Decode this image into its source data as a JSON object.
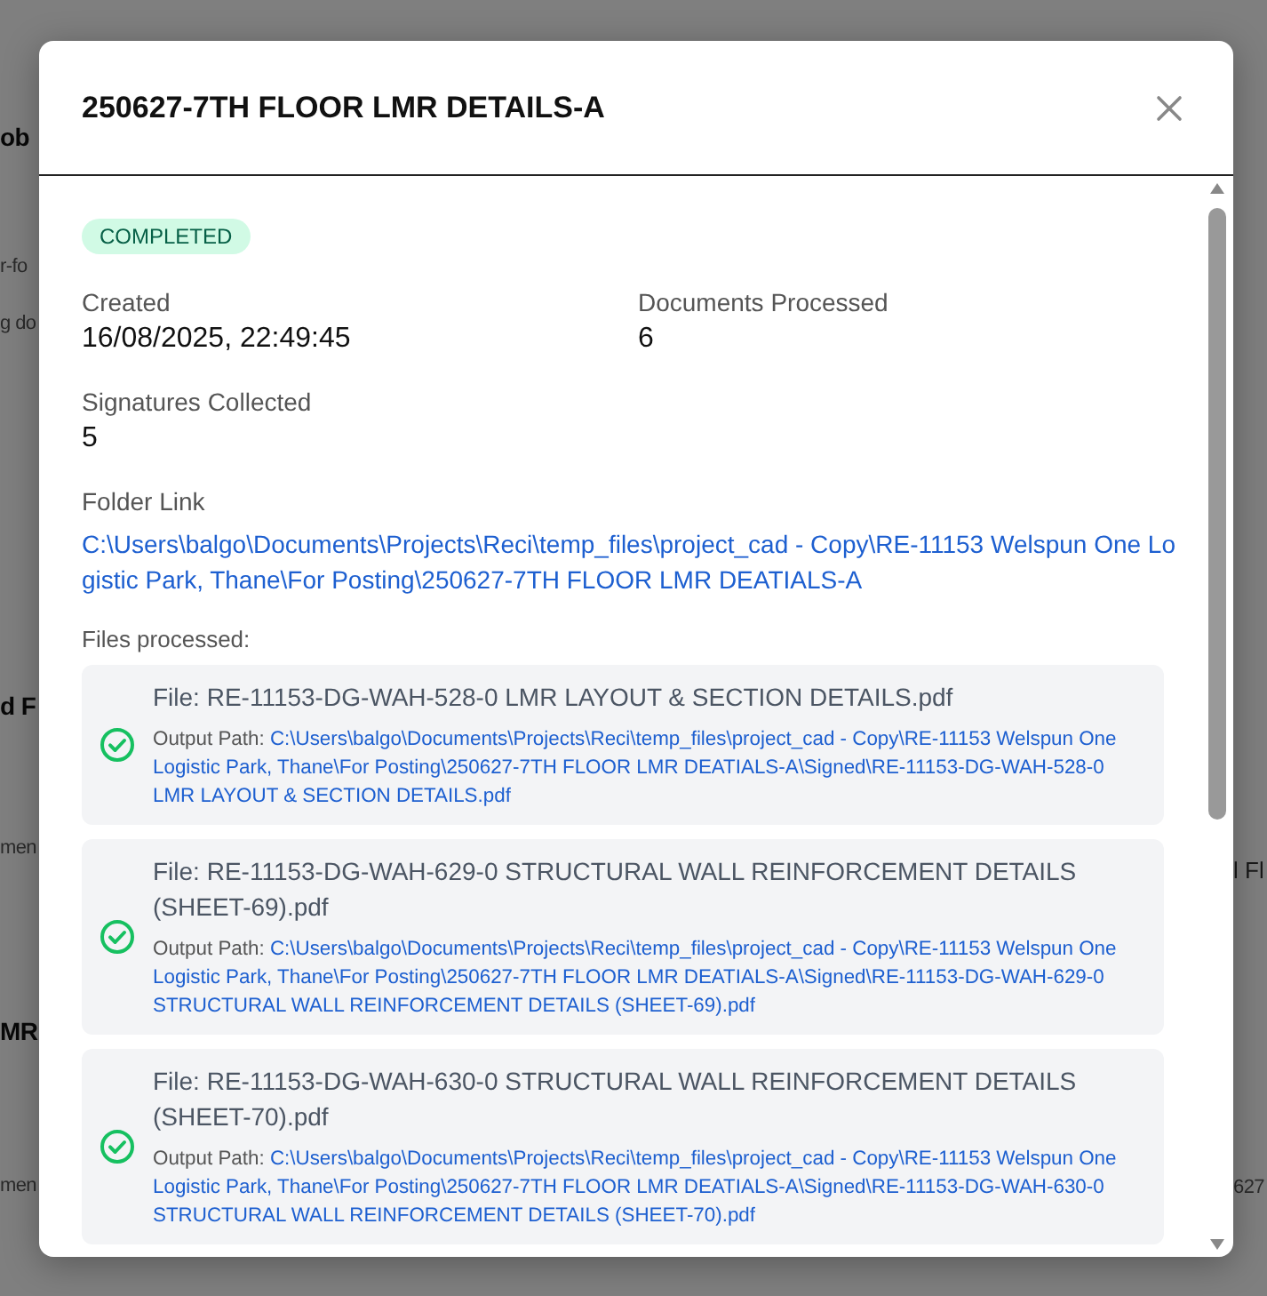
{
  "background": {
    "left": [
      {
        "text": "ob",
        "kind": "heading"
      },
      {
        "text": "r-fo",
        "kind": "small"
      },
      {
        "text": "g do",
        "kind": "small"
      },
      {
        "text": "d F",
        "kind": "heading"
      },
      {
        "text": "men",
        "kind": "small"
      },
      {
        "text": "MR",
        "kind": "heading"
      },
      {
        "text": "men",
        "kind": "small"
      }
    ],
    "right": [
      {
        "text": "l Fl",
        "kind": "body"
      },
      {
        "text": "627",
        "kind": "small"
      }
    ]
  },
  "dialog": {
    "title": "250627-7TH FLOOR LMR DETAILS-A",
    "status": "COMPLETED",
    "fields": [
      {
        "label": "Created",
        "value": "16/08/2025, 22:49:45"
      },
      {
        "label": "Documents Processed",
        "value": "6"
      },
      {
        "label": "Signatures Collected",
        "value": "5"
      }
    ],
    "folder": {
      "label": "Folder Link",
      "path": "C:\\Users\\balgo\\Documents\\Projects\\Reci\\temp_files\\project_cad - Copy\\RE-11153 Welspun One Logistic Park, Thane\\For Posting\\250627-7TH FLOOR LMR DEATIALS-A"
    },
    "files_heading": "Files processed:",
    "files": [
      {
        "name": "File: RE-11153-DG-WAH-528-0 LMR LAYOUT & SECTION DETAILS.pdf",
        "output_label": "Output Path:",
        "output_path": "C:\\Users\\balgo\\Documents\\Projects\\Reci\\temp_files\\project_cad - Copy\\RE-11153 Welspun One Logistic Park, Thane\\For Posting\\250627-7TH FLOOR LMR DEATIALS-A\\Signed\\RE-11153-DG-WAH-528-0 LMR LAYOUT & SECTION DETAILS.pdf",
        "ok": true
      },
      {
        "name": "File: RE-11153-DG-WAH-629-0 STRUCTURAL WALL REINFORCEMENT DETAILS (SHEET-69).pdf",
        "output_label": "Output Path:",
        "output_path": "C:\\Users\\balgo\\Documents\\Projects\\Reci\\temp_files\\project_cad - Copy\\RE-11153 Welspun One Logistic Park, Thane\\For Posting\\250627-7TH FLOOR LMR DEATIALS-A\\Signed\\RE-11153-DG-WAH-629-0 STRUCTURAL WALL REINFORCEMENT DETAILS (SHEET-69).pdf",
        "ok": true
      },
      {
        "name": "File: RE-11153-DG-WAH-630-0 STRUCTURAL WALL REINFORCEMENT DETAILS (SHEET-70).pdf",
        "output_label": "Output Path:",
        "output_path": "C:\\Users\\balgo\\Documents\\Projects\\Reci\\temp_files\\project_cad - Copy\\RE-11153 Welspun One Logistic Park, Thane\\For Posting\\250627-7TH FLOOR LMR DEATIALS-A\\Signed\\RE-11153-DG-WAH-630-0 STRUCTURAL WALL REINFORCEMENT DETAILS (SHEET-70).pdf",
        "ok": true
      }
    ]
  }
}
